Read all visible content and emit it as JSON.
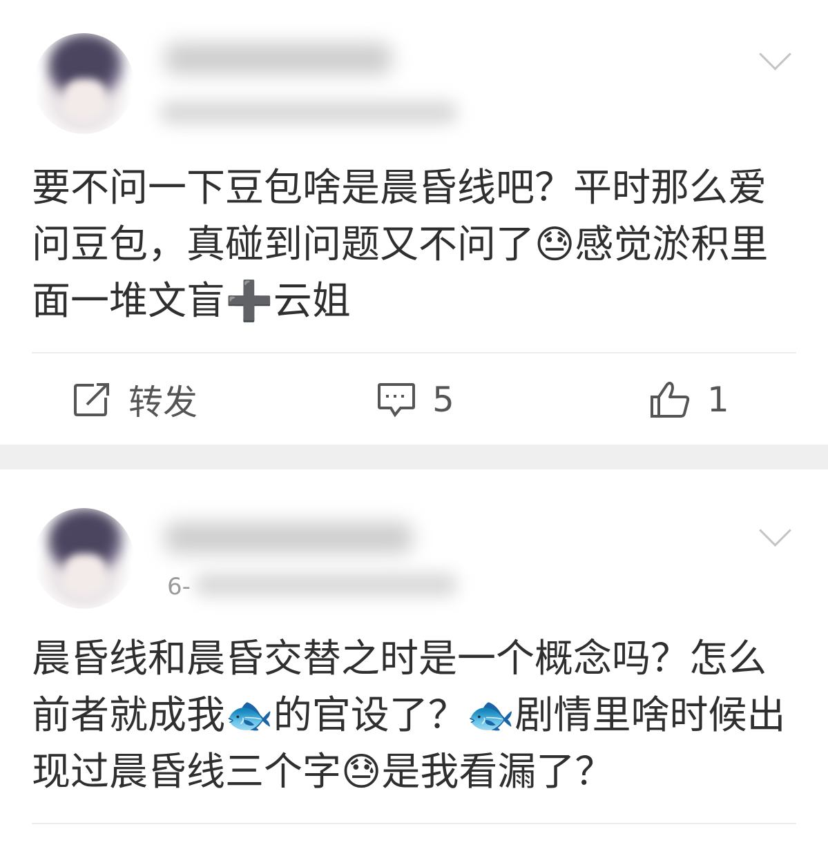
{
  "posts": [
    {
      "meta_prefix": "",
      "text": "要不问一下豆包啥是晨昏线吧？平时那么爱问豆包，真碰到问题又不问了😓感觉淤积里面一堆文盲➕云姐",
      "actions": {
        "repost_label": "转发",
        "comment_count": "5",
        "like_count": "1"
      }
    },
    {
      "meta_prefix": "6-",
      "text": "晨昏线和晨昏交替之时是一个概念吗？怎么前者就成我🐟的官设了？🐟剧情里啥时候出现过晨昏线三个字😓是我看漏了？"
    }
  ],
  "icons": {
    "more": "chevron-down-icon",
    "repost": "repost-icon",
    "comment": "comment-icon",
    "like": "thumbs-up-icon"
  },
  "colors": {
    "text": "#2f2f2f",
    "icon": "#555555",
    "separator": "#efefef"
  }
}
